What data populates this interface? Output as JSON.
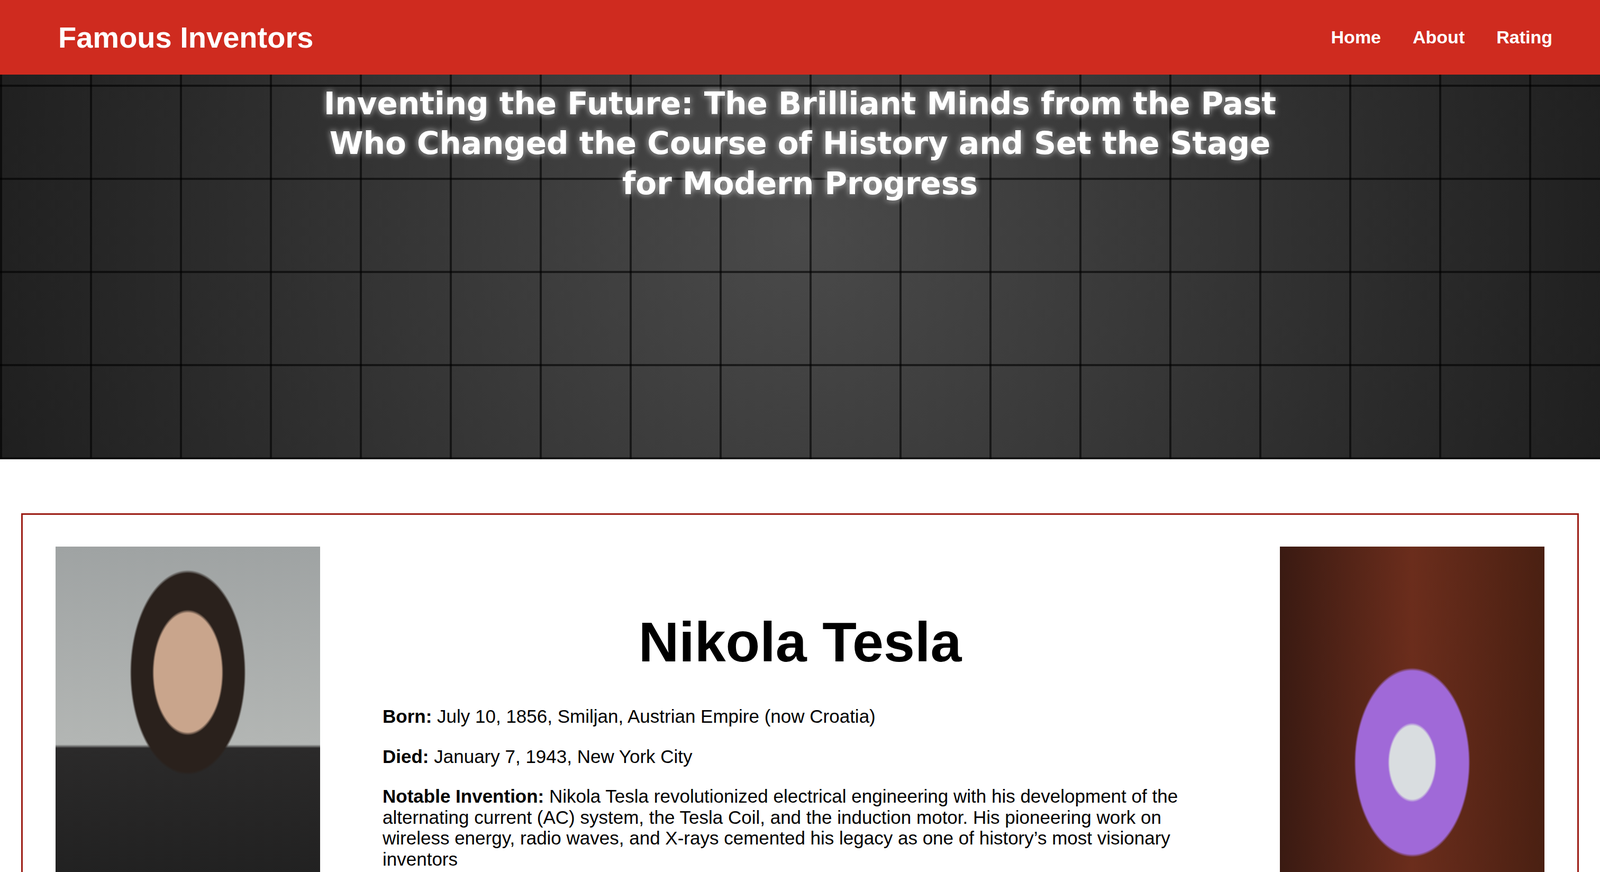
{
  "header": {
    "title": "Famous Inventors",
    "nav": [
      {
        "label": "Home",
        "selected": false
      },
      {
        "label": "About",
        "selected": false
      },
      {
        "label": "Rating",
        "selected": false
      }
    ]
  },
  "hero": {
    "title": "Inventing the Future: The Brilliant Minds from the Past Who Changed the Course of History and Set the Stage for Modern Progress"
  },
  "inventor": {
    "name": "Nikola Tesla",
    "facts": [
      {
        "label": "Born:",
        "value": "July 10, 1856, Smiljan, Austrian Empire (now Croatia)"
      },
      {
        "label": "Died:",
        "value": "January 7, 1943, New York City"
      },
      {
        "label": "Notable Invention:",
        "value": "Nikola Tesla revolutionized electrical engineering with his development of the alternating current (AC) system, the Tesla Coil, and the induction motor. His pioneering work on wireless energy, radio waves, and X-rays cemented his legacy as one of history’s most visionary inventors"
      }
    ]
  }
}
